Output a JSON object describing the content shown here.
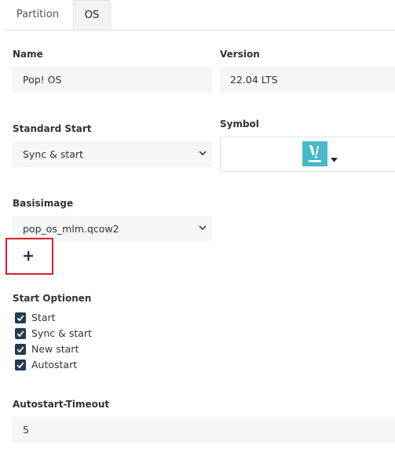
{
  "tabs": [
    {
      "label": "Partition"
    },
    {
      "label": "OS"
    }
  ],
  "form": {
    "name": {
      "label": "Name",
      "value": "Pop! OS"
    },
    "version": {
      "label": "Version",
      "value": "22.04 LTS"
    },
    "standard_start": {
      "label": "Standard Start",
      "value": "Sync & start"
    },
    "symbol": {
      "label": "Symbol",
      "icon": "pop-os-logo-icon"
    },
    "basisimage": {
      "label": "Basisimage",
      "value": "pop_os_mlm.qcow2"
    },
    "add_button": {
      "label": "+"
    },
    "start_options": {
      "label": "Start Optionen",
      "items": [
        {
          "label": "Start",
          "checked": true
        },
        {
          "label": "Sync & start",
          "checked": true
        },
        {
          "label": "New start",
          "checked": true
        },
        {
          "label": "Autostart",
          "checked": true
        }
      ]
    },
    "autostart_timeout": {
      "label": "Autostart-Timeout",
      "value": "5"
    }
  },
  "colors": {
    "field_bg": "#f4f6f8",
    "checkbox": "#1f3b57",
    "highlight": "#e11d2a",
    "pop_os_icon": "#48b9c7"
  }
}
